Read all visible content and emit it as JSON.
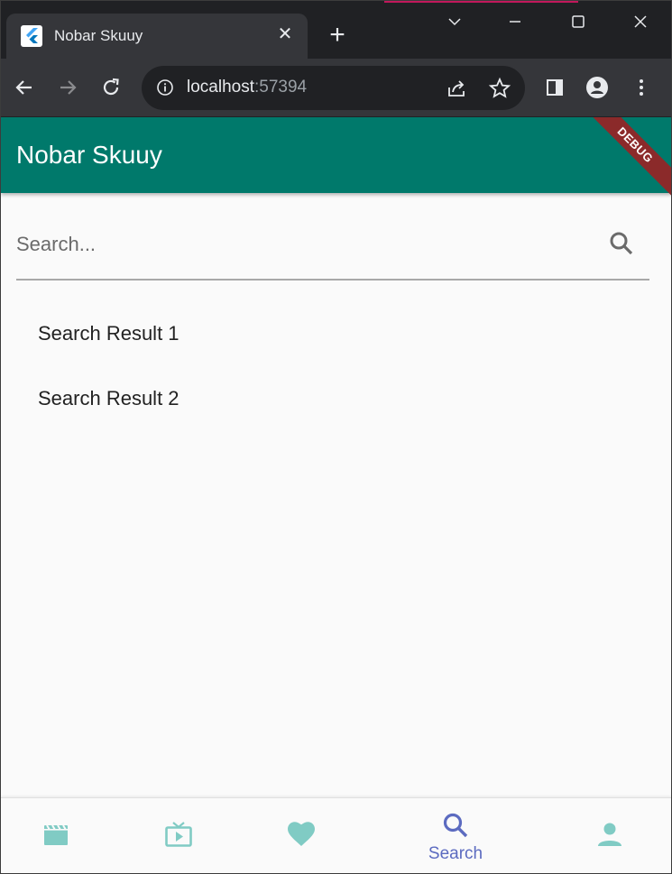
{
  "browser": {
    "tab_title": "Nobar Skuuy",
    "close_glyph": "✕",
    "newtab_glyph": "+",
    "url_host": "localhost",
    "url_port": ":57394"
  },
  "app": {
    "title": "Nobar Skuuy",
    "debug_banner": "DEBUG",
    "colors": {
      "appbar": "#00796b",
      "nav_icon": "#80cbc4",
      "nav_active": "#5c6bc0"
    }
  },
  "search": {
    "placeholder": "Search...",
    "value": ""
  },
  "results": [
    {
      "label": "Search Result 1"
    },
    {
      "label": "Search Result 2"
    }
  ],
  "bottom_nav": {
    "items": [
      {
        "icon": "movie-icon",
        "label": ""
      },
      {
        "icon": "tv-icon",
        "label": ""
      },
      {
        "icon": "heart-icon",
        "label": ""
      },
      {
        "icon": "search-icon",
        "label": "Search",
        "active": true
      },
      {
        "icon": "person-icon",
        "label": ""
      }
    ]
  }
}
